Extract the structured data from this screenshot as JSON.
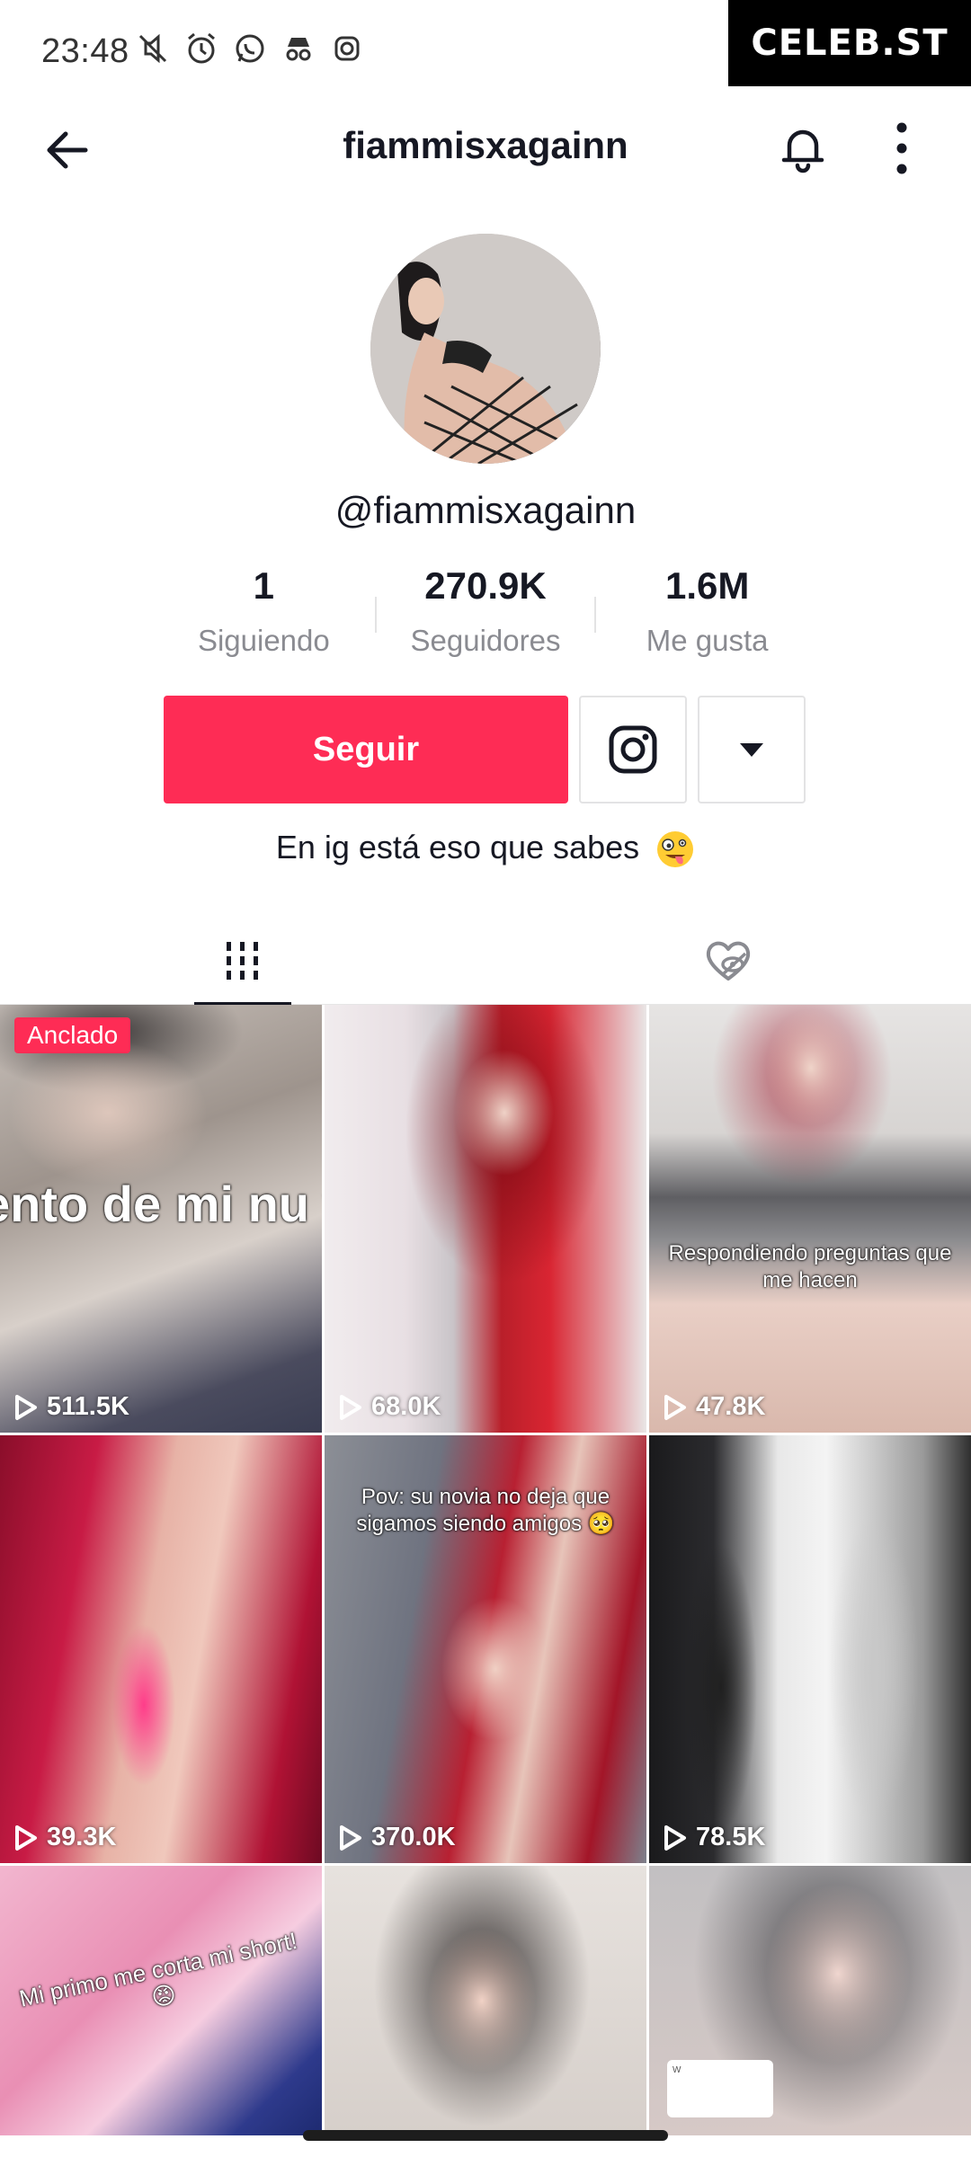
{
  "status_bar": {
    "time": "23:48",
    "icons": [
      "mute-icon",
      "alarm-icon",
      "whatsapp-icon",
      "incognito-icon",
      "instagram-icon"
    ]
  },
  "watermark": "CELEB.ST",
  "header": {
    "title": "fiammisxagainn",
    "back_icon": "arrow-left-icon",
    "bell_icon": "bell-icon",
    "more_icon": "more-vertical-icon"
  },
  "profile": {
    "handle": "@fiammisxagainn",
    "stats": [
      {
        "value": "1",
        "label": "Siguiendo"
      },
      {
        "value": "270.9K",
        "label": "Seguidores"
      },
      {
        "value": "1.6M",
        "label": "Me gusta"
      }
    ],
    "follow_label": "Seguir",
    "bio": "En ig está eso que sabes"
  },
  "colors": {
    "accent": "#fe2c55",
    "text": "#161823",
    "muted": "#8a8b91",
    "border": "#e3e3e4"
  },
  "tabs": {
    "videos_icon": "grid-icon",
    "liked_icon": "hidden-heart-icon"
  },
  "videos": [
    {
      "views": "511.5K",
      "pinned_label": "Anclado",
      "caption": "ento de mi nu video 🔥🔥"
    },
    {
      "views": "68.0K"
    },
    {
      "views": "47.8K",
      "caption": "Respondiendo preguntas que me hacen"
    },
    {
      "views": "39.3K"
    },
    {
      "views": "370.0K",
      "caption": "Pov: su novia no deja que sigamos siendo amigos 🥺"
    },
    {
      "views": "78.5K"
    },
    {
      "caption": "Mi primo me corta mi short!😡"
    },
    {},
    {
      "reply_text": "W"
    }
  ]
}
